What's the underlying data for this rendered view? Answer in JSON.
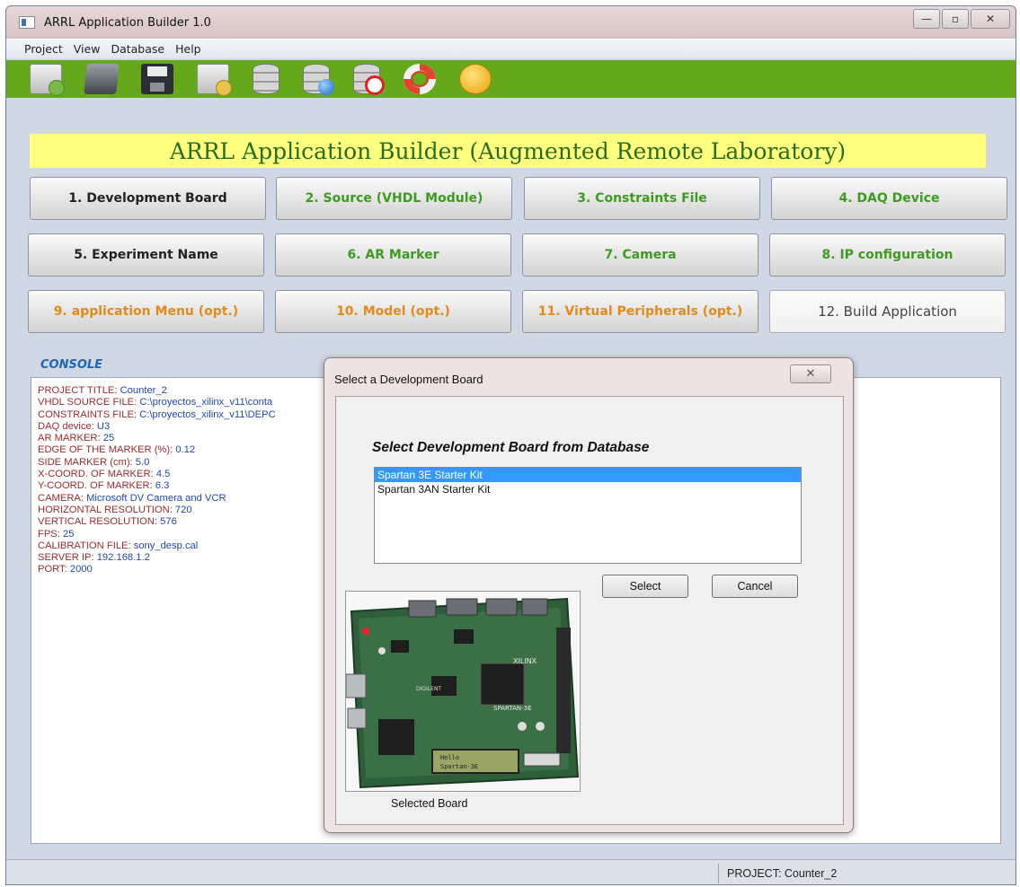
{
  "window": {
    "title": "ARRL Application Builder 1.0",
    "controls": {
      "minimize": "—",
      "maximize": "▫",
      "close": "✕"
    }
  },
  "menu": [
    "Project",
    "View",
    "Database",
    "Help"
  ],
  "toolbar": {
    "icons": [
      "new-project-icon",
      "open-folder-icon",
      "save-icon",
      "new-document-icon",
      "database-icon",
      "database-web-icon",
      "database-delete-icon",
      "help-ring-icon",
      "about-icon"
    ],
    "background": "#65a81c"
  },
  "banner": {
    "title": "ARRL Application Builder (Augmented Remote Laboratory)",
    "text_color": "#2c6c1c",
    "background": "#ffff80"
  },
  "steps": [
    {
      "label": "1. Development Board",
      "style": "dark"
    },
    {
      "label": "2. Source (VHDL Module)",
      "style": "green"
    },
    {
      "label": "3. Constraints File",
      "style": "green"
    },
    {
      "label": "4. DAQ Device",
      "style": "green"
    },
    {
      "label": "5. Experiment Name",
      "style": "dark"
    },
    {
      "label": "6. AR Marker",
      "style": "green"
    },
    {
      "label": "7. Camera",
      "style": "green"
    },
    {
      "label": "8. IP configuration",
      "style": "green"
    },
    {
      "label": "9. application Menu (opt.)",
      "style": "orange"
    },
    {
      "label": "10. Model (opt.)",
      "style": "orange"
    },
    {
      "label": "11. Virtual Peripherals (opt.)",
      "style": "orange"
    },
    {
      "label": "12. Build Application",
      "style": "plain"
    }
  ],
  "console": {
    "label": "CONSOLE",
    "lines": [
      {
        "key": "PROJECT TITLE: ",
        "value": "Counter_2"
      },
      {
        "key": "VHDL SOURCE FILE: ",
        "value": "C:\\proyectos_xilinx_v11\\conta"
      },
      {
        "key": "CONSTRAINTS FILE: ",
        "value": "C:\\proyectos_xilinx_v11\\DEPC"
      },
      {
        "key": "DAQ device: ",
        "value": "U3"
      },
      {
        "key": "AR MARKER: ",
        "value": "25"
      },
      {
        "key": "EDGE OF THE MARKER (%): ",
        "value": "0.12"
      },
      {
        "key": "SIDE MARKER (cm): ",
        "value": "5.0"
      },
      {
        "key": "X-COORD. OF MARKER: ",
        "value": "4.5"
      },
      {
        "key": "Y-COORD. OF MARKER: ",
        "value": "6.3"
      },
      {
        "key": "CAMERA: ",
        "value": "Microsoft DV Camera and VCR"
      },
      {
        "key": "HORIZONTAL RESOLUTION: ",
        "value": "720"
      },
      {
        "key": "VERTICAL RESOLUTION: ",
        "value": "576"
      },
      {
        "key": "FPS: ",
        "value": "25"
      },
      {
        "key": "CALIBRATION FILE: ",
        "value": "sony_desp.cal"
      },
      {
        "key": "SERVER IP: ",
        "value": "192.168.1.2"
      },
      {
        "key": "PORT: ",
        "value": "2000"
      }
    ]
  },
  "dialog": {
    "title": "Select a Development Board",
    "close": "✕",
    "heading": "Select Development Board from Database",
    "options": [
      {
        "label": "Spartan 3E Starter Kit",
        "selected": true
      },
      {
        "label": "Spartan 3AN Starter Kit",
        "selected": false
      }
    ],
    "select_label": "Select",
    "cancel_label": "Cancel",
    "image_caption": "Selected Board",
    "board_text": {
      "brand": "XILINX",
      "chip": "SPARTAN-3E",
      "lcd_line1": "Hello",
      "lcd_line2": "Spartan-3E",
      "maker": "DIGILENT"
    }
  },
  "status": {
    "project": "PROJECT: Counter_2"
  }
}
